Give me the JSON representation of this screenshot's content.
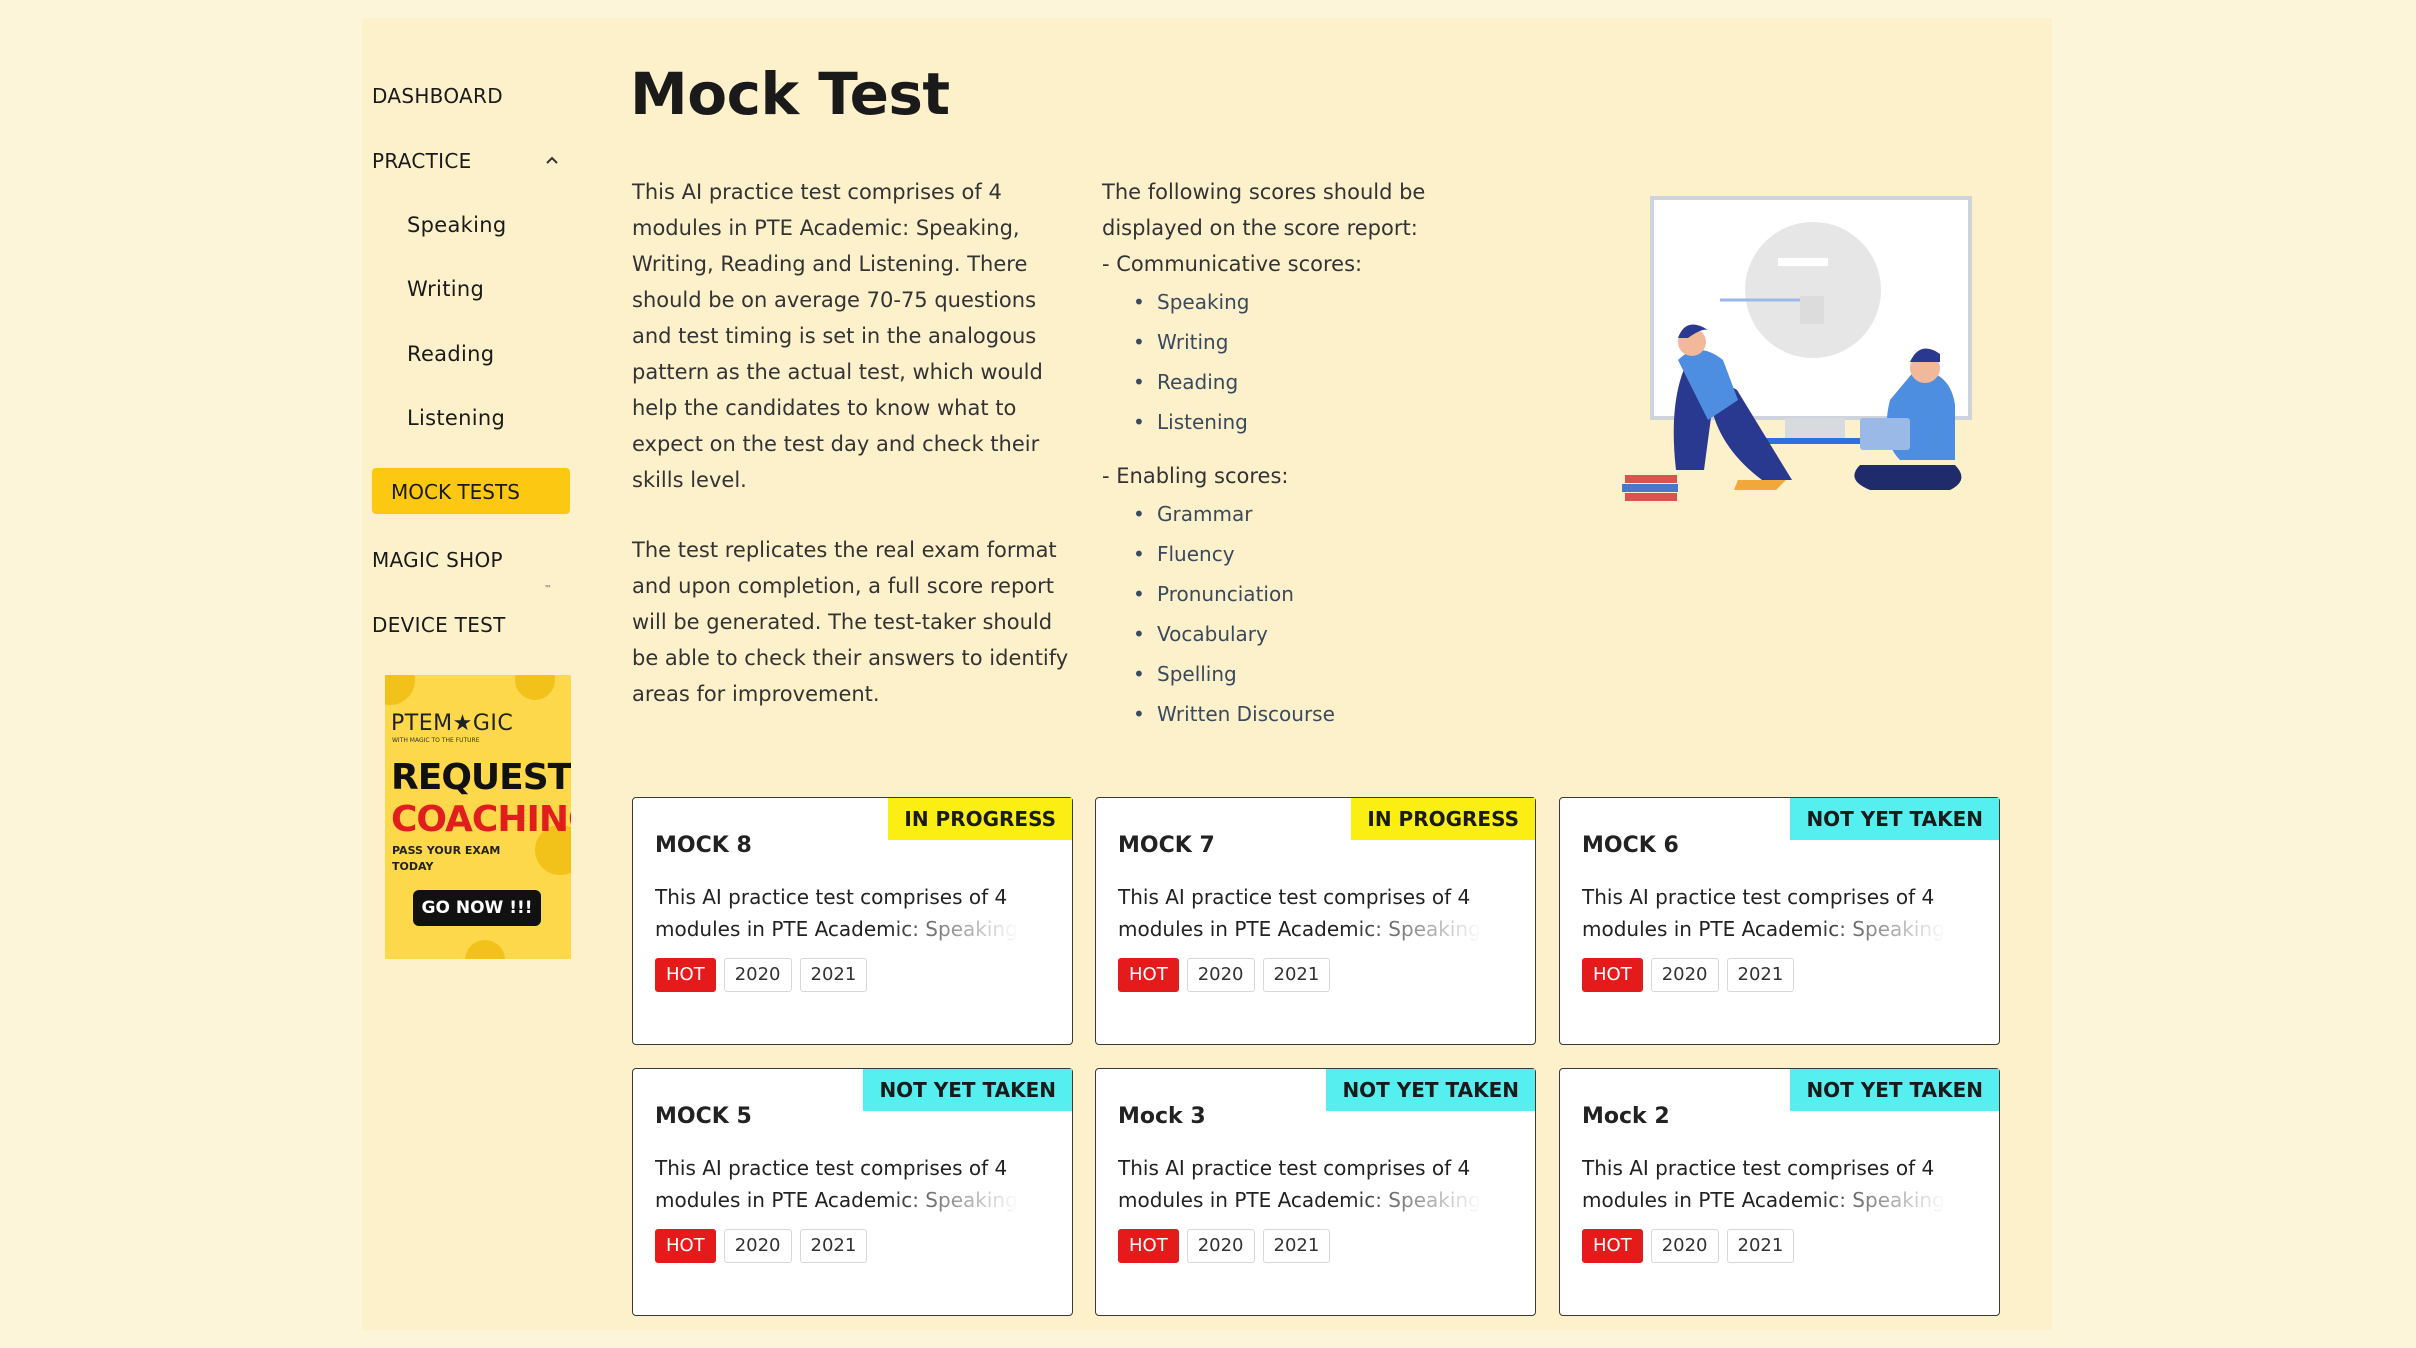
{
  "sidebar": {
    "dashboard": "DASHBOARD",
    "practice": "PRACTICE",
    "practice_items": [
      "Speaking",
      "Writing",
      "Reading",
      "Listening"
    ],
    "mock_tests": "MOCK TESTS",
    "magic_shop": "MAGIC SHOP",
    "trademark": "™",
    "device_test": "DEVICE TEST"
  },
  "ad": {
    "logo_prefix": "PTEM",
    "logo_star": "★",
    "logo_suffix": "GIC",
    "tagline": "WITH MAGIC TO THE FUTURE",
    "line1": "REQUEST",
    "line2": "COACHING",
    "line3": "PASS YOUR EXAM TODAY",
    "button": "GO NOW !!!"
  },
  "page": {
    "title": "Mock Test",
    "para1": "This AI practice test comprises of 4 modules in PTE Academic: Speaking, Writing, Reading and Listening. There should be on average 70-75 questions and test timing is set in the analogous pattern as the actual test, which would help the candidates to know what to expect on the test day and check their skills level.",
    "para2": "The test replicates the real exam format and upon completion, a full score report will be generated. The test-taker should be able to check their answers to identify areas for improvement.",
    "scores_intro": "The following scores should be displayed on the score report:",
    "communicative_heading": "- Communicative scores:",
    "communicative": [
      "Speaking",
      "Writing",
      "Reading",
      "Listening"
    ],
    "enabling_heading": "- Enabling scores:",
    "enabling": [
      "Grammar",
      "Fluency",
      "Pronunciation",
      "Vocabulary",
      "Spelling",
      "Written Discourse"
    ]
  },
  "cards": [
    {
      "title": "MOCK 8",
      "status": "IN PROGRESS",
      "desc": "This AI practice test comprises of 4 modules in PTE Academic: Speaking, Writing",
      "tags": [
        "HOT",
        "2020",
        "2021"
      ]
    },
    {
      "title": "MOCK 7",
      "status": "IN PROGRESS",
      "desc": "This AI practice test comprises of 4 modules in PTE Academic: Speaking, Writing",
      "tags": [
        "HOT",
        "2020",
        "2021"
      ]
    },
    {
      "title": "MOCK 6",
      "status": "NOT YET TAKEN",
      "desc": "This AI practice test comprises of 4 modules in PTE Academic: Speaking, Writing",
      "tags": [
        "HOT",
        "2020",
        "2021"
      ]
    },
    {
      "title": "MOCK 5",
      "status": "NOT YET TAKEN",
      "desc": "This AI practice test comprises of 4 modules in PTE Academic: Speaking, Writing",
      "tags": [
        "HOT",
        "2020",
        "2021"
      ]
    },
    {
      "title": "Mock 3",
      "status": "NOT YET TAKEN",
      "desc": "This AI practice test comprises of 4 modules in PTE Academic: Speaking, Writing",
      "tags": [
        "HOT",
        "2020",
        "2021"
      ]
    },
    {
      "title": "Mock 2",
      "status": "NOT YET TAKEN",
      "desc": "This AI practice test comprises of 4 modules in PTE Academic: Speaking, Writing",
      "tags": [
        "HOT",
        "2020",
        "2021"
      ]
    }
  ],
  "colors": {
    "background": "#fdf5d9",
    "active_nav": "#fdc812",
    "in_progress": "#fbee12",
    "not_yet_taken": "#55eff0",
    "hot": "#e51a1a"
  }
}
